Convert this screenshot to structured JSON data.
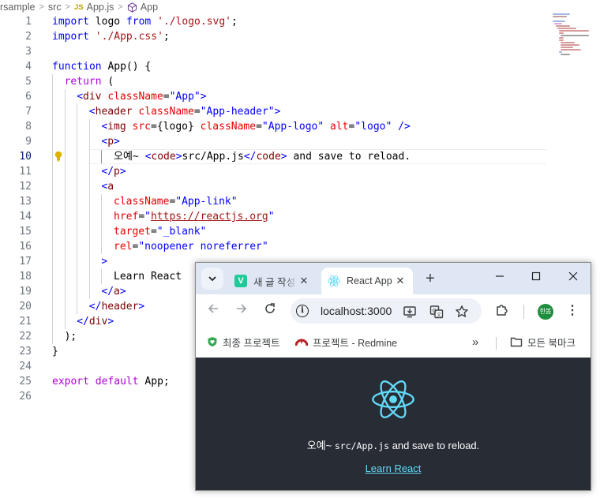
{
  "breadcrumb": {
    "root": "rsample",
    "folder": "src",
    "file_badge": "JS",
    "file": "App.js",
    "symbol": "App"
  },
  "editor": {
    "active_line": 10,
    "lines": [
      {
        "n": "1",
        "indent": 0,
        "tokens": [
          [
            "k",
            "import"
          ],
          [
            "p",
            " logo "
          ],
          [
            "k",
            "from"
          ],
          [
            "p",
            " "
          ],
          [
            "s",
            "'./logo.svg'"
          ],
          [
            "p",
            ";"
          ]
        ]
      },
      {
        "n": "2",
        "indent": 0,
        "tokens": [
          [
            "k",
            "import"
          ],
          [
            "p",
            " "
          ],
          [
            "s",
            "'./App.css'"
          ],
          [
            "p",
            ";"
          ]
        ]
      },
      {
        "n": "3",
        "indent": 0,
        "tokens": []
      },
      {
        "n": "4",
        "indent": 0,
        "tokens": [
          [
            "k",
            "function"
          ],
          [
            "p",
            " App() {"
          ]
        ]
      },
      {
        "n": "5",
        "indent": 1,
        "tokens": [
          [
            "cf",
            "return"
          ],
          [
            "p",
            " ("
          ]
        ]
      },
      {
        "n": "6",
        "indent": 2,
        "tokens": [
          [
            "k",
            "<"
          ],
          [
            "tag",
            "div"
          ],
          [
            "p",
            " "
          ],
          [
            "at",
            "className"
          ],
          [
            "p",
            "="
          ],
          [
            "k",
            "\"App\""
          ],
          [
            "k",
            ">"
          ]
        ]
      },
      {
        "n": "7",
        "indent": 3,
        "tokens": [
          [
            "k",
            "<"
          ],
          [
            "tag",
            "header"
          ],
          [
            "p",
            " "
          ],
          [
            "at",
            "className"
          ],
          [
            "p",
            "="
          ],
          [
            "k",
            "\"App-header\""
          ],
          [
            "k",
            ">"
          ]
        ]
      },
      {
        "n": "8",
        "indent": 4,
        "tokens": [
          [
            "k",
            "<"
          ],
          [
            "tag",
            "img"
          ],
          [
            "p",
            " "
          ],
          [
            "at",
            "src"
          ],
          [
            "p",
            "={logo} "
          ],
          [
            "at",
            "className"
          ],
          [
            "p",
            "="
          ],
          [
            "k",
            "\"App-logo\""
          ],
          [
            "p",
            " "
          ],
          [
            "at",
            "alt"
          ],
          [
            "p",
            "="
          ],
          [
            "k",
            "\"logo\""
          ],
          [
            "p",
            " "
          ],
          [
            "k",
            "/>"
          ]
        ]
      },
      {
        "n": "9",
        "indent": 4,
        "tokens": [
          [
            "k",
            "<"
          ],
          [
            "tag",
            "p"
          ],
          [
            "k",
            ">"
          ]
        ]
      },
      {
        "n": "10",
        "indent": 5,
        "tokens": [
          [
            "p",
            "오예~ "
          ],
          [
            "k",
            "<"
          ],
          [
            "tag",
            "code"
          ],
          [
            "k",
            ">"
          ],
          [
            "p",
            "src/App.js"
          ],
          [
            "k",
            "</"
          ],
          [
            "tag",
            "code"
          ],
          [
            "k",
            ">"
          ],
          [
            "p",
            " and save to reload."
          ]
        ]
      },
      {
        "n": "11",
        "indent": 4,
        "tokens": [
          [
            "k",
            "</"
          ],
          [
            "tag",
            "p"
          ],
          [
            "k",
            ">"
          ]
        ]
      },
      {
        "n": "12",
        "indent": 4,
        "tokens": [
          [
            "k",
            "<"
          ],
          [
            "tag",
            "a"
          ]
        ]
      },
      {
        "n": "13",
        "indent": 5,
        "tokens": [
          [
            "at",
            "className"
          ],
          [
            "p",
            "="
          ],
          [
            "k",
            "\"App-link\""
          ]
        ]
      },
      {
        "n": "14",
        "indent": 5,
        "tokens": [
          [
            "at",
            "href"
          ],
          [
            "p",
            "="
          ],
          [
            "k",
            "\""
          ],
          [
            "su",
            "https://reactjs.org"
          ],
          [
            "k",
            "\""
          ]
        ]
      },
      {
        "n": "15",
        "indent": 5,
        "tokens": [
          [
            "at",
            "target"
          ],
          [
            "p",
            "="
          ],
          [
            "k",
            "\"_blank\""
          ]
        ]
      },
      {
        "n": "16",
        "indent": 5,
        "tokens": [
          [
            "at",
            "rel"
          ],
          [
            "p",
            "="
          ],
          [
            "k",
            "\"noopener noreferrer\""
          ]
        ]
      },
      {
        "n": "17",
        "indent": 4,
        "tokens": [
          [
            "k",
            ">"
          ]
        ]
      },
      {
        "n": "18",
        "indent": 5,
        "tokens": [
          [
            "p",
            "Learn React"
          ]
        ]
      },
      {
        "n": "19",
        "indent": 4,
        "tokens": [
          [
            "k",
            "</"
          ],
          [
            "tag",
            "a"
          ],
          [
            "k",
            ">"
          ]
        ]
      },
      {
        "n": "20",
        "indent": 3,
        "tokens": [
          [
            "k",
            "</"
          ],
          [
            "tag",
            "header"
          ],
          [
            "k",
            ">"
          ]
        ]
      },
      {
        "n": "21",
        "indent": 2,
        "tokens": [
          [
            "k",
            "</"
          ],
          [
            "tag",
            "div"
          ],
          [
            "k",
            ">"
          ]
        ]
      },
      {
        "n": "22",
        "indent": 1,
        "tokens": [
          [
            "p",
            ");"
          ]
        ]
      },
      {
        "n": "23",
        "indent": 0,
        "tokens": [
          [
            "p",
            "}"
          ]
        ]
      },
      {
        "n": "24",
        "indent": 0,
        "tokens": []
      },
      {
        "n": "25",
        "indent": 0,
        "tokens": [
          [
            "cf",
            "export"
          ],
          [
            "p",
            " "
          ],
          [
            "cf",
            "default"
          ],
          [
            "p",
            " App;"
          ]
        ]
      },
      {
        "n": "26",
        "indent": 0,
        "tokens": []
      }
    ]
  },
  "browser": {
    "tabs": [
      {
        "title": "새 글 작성",
        "active": false,
        "favicon_color": "#20c997",
        "favicon_letter": "V"
      },
      {
        "title": "React App",
        "active": true,
        "favicon_color": "#61dafb"
      }
    ],
    "url": "localhost:3000",
    "profile_label": "한봄",
    "bookmarks": [
      {
        "label": "최종 프로젝트",
        "icon": "shield-heart-icon"
      },
      {
        "label": "프로젝트 - Redmine",
        "icon": "redmine-icon"
      }
    ],
    "all_bookmarks_label": "모든 북마크",
    "overflow_label": "»",
    "page": {
      "text_before": "오예~ ",
      "code": "src/App.js",
      "text_after": " and save to reload.",
      "link": "Learn React",
      "background": "#282c34",
      "accent": "#61dafb"
    }
  }
}
